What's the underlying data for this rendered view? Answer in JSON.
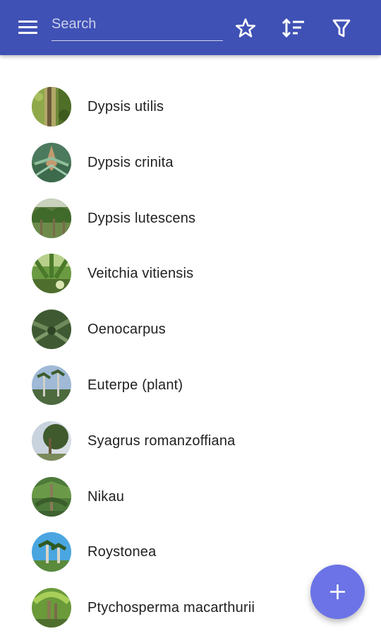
{
  "appbar": {
    "background": "#3f51b5",
    "search_placeholder": "Search",
    "search_value": "",
    "menu_icon": "menu-icon",
    "favorites_icon": "star-outline-icon",
    "sort_icon": "sort-icon",
    "filter_icon": "filter-icon"
  },
  "list": {
    "items": [
      {
        "label": "Dypsis utilis"
      },
      {
        "label": "Dypsis crinita"
      },
      {
        "label": "Dypsis lutescens"
      },
      {
        "label": "Veitchia vitiensis"
      },
      {
        "label": "Oenocarpus"
      },
      {
        "label": "Euterpe (plant)"
      },
      {
        "label": "Syagrus romanzoffiana"
      },
      {
        "label": "Nikau"
      },
      {
        "label": "Roystonea"
      },
      {
        "label": "Ptychosperma macarthurii"
      }
    ]
  },
  "fab": {
    "icon": "plus-icon",
    "color": "#6b73e6"
  }
}
